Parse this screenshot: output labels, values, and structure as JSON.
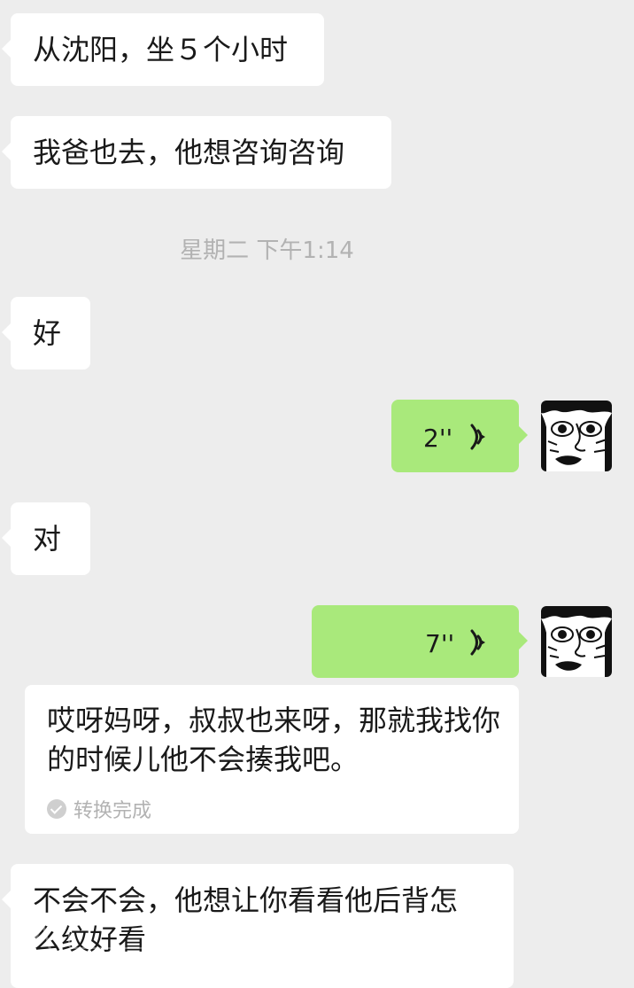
{
  "messages": [
    {
      "text": "从沈阳，坐５个小时"
    },
    {
      "text": "我爸也去，他想咨询咨询"
    },
    {
      "text": "好"
    },
    {
      "voice_duration": "2''"
    },
    {
      "text": "对"
    },
    {
      "voice_duration": "7''"
    },
    {
      "text_line1": "不会不会，他想让你看看他后背怎",
      "text_line2": "么纹好看"
    }
  ],
  "timestamp": "星期二 下午1:14",
  "transcript": {
    "text": "哎呀妈呀，叔叔也来呀，那就我找你的时候儿他不会揍我吧。",
    "status": "转换完成"
  },
  "colors": {
    "background": "#ededed",
    "incoming_bubble": "#ffffff",
    "outgoing_bubble": "#a9e97b"
  }
}
